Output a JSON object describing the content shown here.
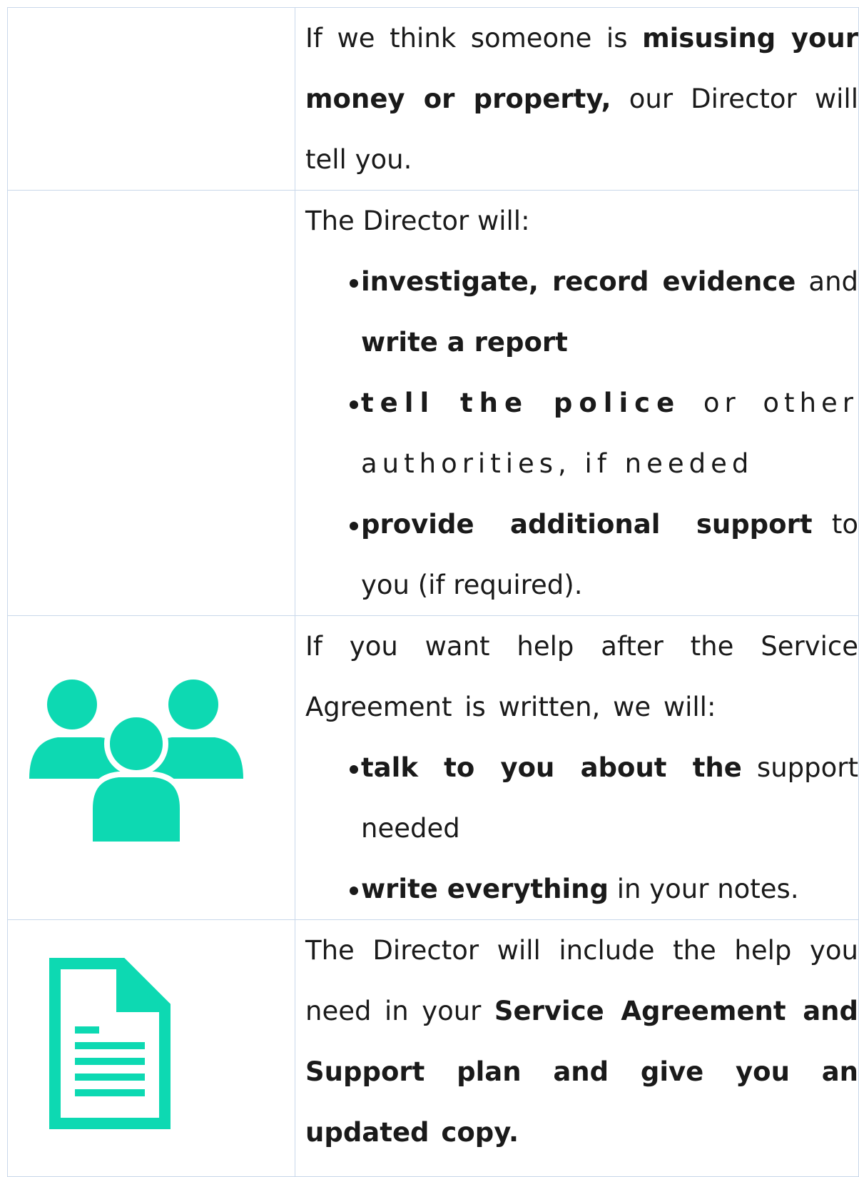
{
  "rows": {
    "r1": {
      "p1_a": "If we think someone is ",
      "p1_b": "misusing your money or property,",
      "p1_c": " our Director will tell you."
    },
    "r2": {
      "intro": "The Director will:",
      "b1_bold1": "investigate, record evidence",
      "b1_mid": " and ",
      "b1_bold2": "write a report",
      "b2_bold": "tell the police",
      "b2_rest": " or other authorities, if needed",
      "b3_bold": "provide additional support",
      "b3_rest": " to you (if required)."
    },
    "r3": {
      "icon": "people-group-icon",
      "intro": "If you want help after the Service Agreement is written, we will:",
      "b1_bold": "talk to you about the",
      "b1_rest": " support needed",
      "b2_bold": "write everything",
      "b2_rest": " in your notes."
    },
    "r4": {
      "icon": "document-icon",
      "p_a": "The Director will include the help you need in your ",
      "p_b": "Service Agreement and Support plan and give you an updated copy."
    }
  },
  "colors": {
    "icon": "#0dd9b2",
    "border": "#c9d8ea",
    "text": "#1a1a1a"
  }
}
